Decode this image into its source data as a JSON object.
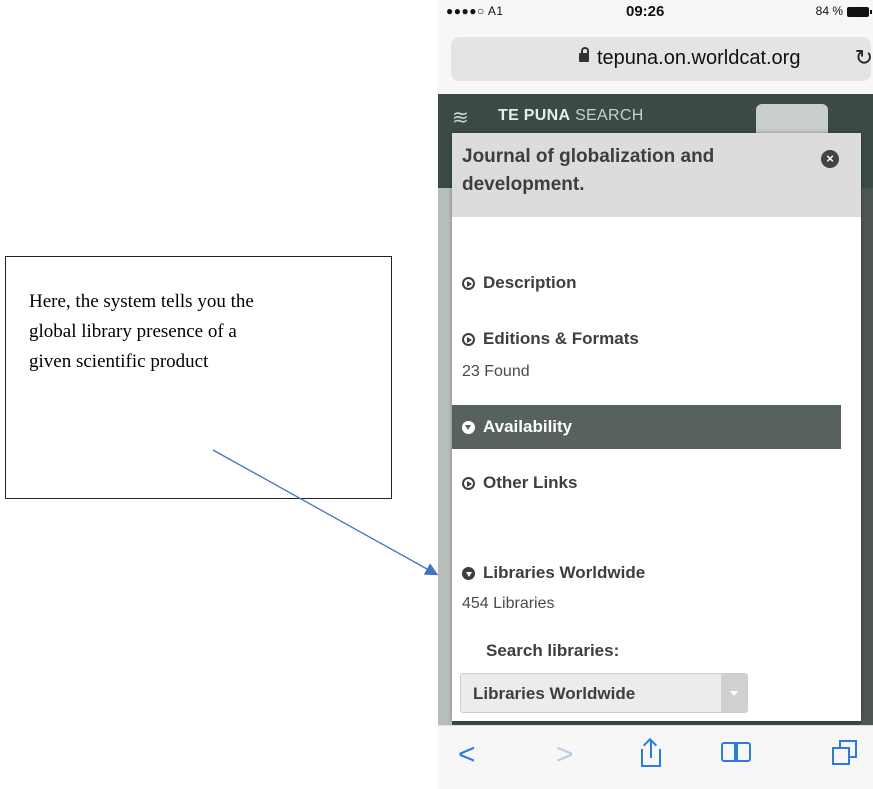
{
  "callout": {
    "lines": [
      "Here, the system tells you the",
      "global library presence of a",
      "given scientific product"
    ]
  },
  "status_bar": {
    "carrier": "●●●●○ A1",
    "time": "09:26",
    "battery": "84 %"
  },
  "browser": {
    "url": "tepuna.on.worldcat.org"
  },
  "site": {
    "brand_bold": "TE PUNA",
    "brand_light": "SEARCH"
  },
  "modal": {
    "title": "Journal of globalization and development.",
    "sections": {
      "description": "Description",
      "editions": "Editions & Formats",
      "editions_count": "23 Found",
      "availability": "Availability",
      "other_links": "Other Links",
      "libraries": "Libraries Worldwide",
      "libraries_count": "454 Libraries"
    },
    "search_label": "Search libraries:",
    "select_value": "Libraries Worldwide"
  },
  "icons": {
    "lock": "lock-icon",
    "reload": "reload-icon",
    "close": "close-icon",
    "back": "back-icon",
    "forward": "forward-icon",
    "share": "share-icon",
    "bookmarks": "bookmarks-icon",
    "tabs": "tabs-icon"
  },
  "colors": {
    "accent_blue": "#2e7be0",
    "site_dark": "#3f4c48",
    "availability_bar": "#57625f"
  }
}
